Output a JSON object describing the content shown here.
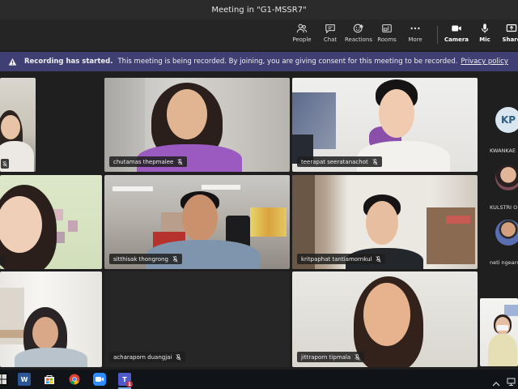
{
  "window": {
    "title": "Meeting in \"G1-MSSR7\""
  },
  "toolbar": {
    "people": "People",
    "chat": "Chat",
    "reactions": "Reactions",
    "rooms": "Rooms",
    "more": "More",
    "camera": "Camera",
    "mic": "Mic",
    "share": "Share"
  },
  "banner": {
    "title": "Recording has started.",
    "message": "This meeting is being recorded. By joining, you are giving consent for this meeting to be recorded.",
    "link": "Privacy policy"
  },
  "participants": [
    {
      "name": "chutamas thepmalee"
    },
    {
      "name": "teerapat seeratanachot"
    },
    {
      "name": "sitthisak thongrong"
    },
    {
      "name": "kritpaphat tantiamornkul"
    },
    {
      "name": "acharaporn duangjai"
    },
    {
      "name": "jittraporn tipmala"
    }
  ],
  "roster": [
    {
      "initials": "KP",
      "name": "KWANKAE"
    },
    {
      "name": "KULSTRI O"
    },
    {
      "name": "neti ngeard"
    }
  ],
  "taskbar": {
    "word_letter": "W",
    "teams_letter": "T",
    "teams_badge": "1"
  },
  "colors": {
    "banner": "#3f3f73",
    "stage": "#1f1f1f",
    "accent": "#7aa7e6"
  }
}
